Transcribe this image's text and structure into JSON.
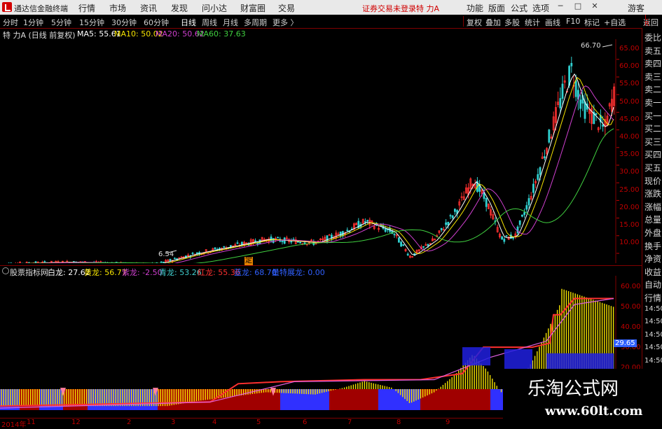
{
  "app": {
    "title": "通达信金融终端"
  },
  "menu": [
    "行情",
    "市场",
    "资讯",
    "发现",
    "问小达",
    "财富圈",
    "交易"
  ],
  "login_warning": "证券交易未登录",
  "stock_name": "特 力A",
  "right_menu": [
    "功能",
    "版面",
    "公式",
    "选项",
    "游客"
  ],
  "periods": [
    "分时",
    "1分钟",
    "5分钟",
    "15分钟",
    "30分钟",
    "60分钟",
    "日线",
    "周线",
    "月线",
    "多周期",
    "更多 〉"
  ],
  "active_period": "日线",
  "tools": [
    "复权",
    "叠加",
    "多股",
    "统计",
    "画线",
    "F10",
    "标记",
    "+自选",
    "返回"
  ],
  "main_chart": {
    "title": "特 力A (日线 前复权)",
    "ma": [
      {
        "label": "MA5: 55.61",
        "color": "#ffffff"
      },
      {
        "label": "MA10: 50.02",
        "color": "#f5e300"
      },
      {
        "label": "MA20: 50.62",
        "color": "#d040d0"
      },
      {
        "label": "MA60: 37.63",
        "color": "#40d040"
      }
    ],
    "high_label": "66.70",
    "low_label": "6.54",
    "price_axis": [
      "65.00",
      "60.00",
      "55.00",
      "50.00",
      "45.00",
      "40.00",
      "35.00",
      "30.00",
      "25.00",
      "20.00",
      "15.00",
      "10.00"
    ],
    "marker": "定"
  },
  "indicator": {
    "name": "股票指标网",
    "items": [
      {
        "label": "白龙: 27.62",
        "color": "#ffffff"
      },
      {
        "label": "黄龙: 56.77",
        "color": "#f5e300"
      },
      {
        "label": "紫龙: -2.50",
        "color": "#d040d0"
      },
      {
        "label": "青龙: 53.26",
        "color": "#40d0d0"
      },
      {
        "label": "红龙: 55.36",
        "color": "#ff3030"
      },
      {
        "label": "蓝龙: 68.70",
        "color": "#3060ff"
      },
      {
        "label": "量特展龙: 0.00",
        "color": "#3060ff"
      }
    ],
    "axis": [
      "60.00",
      "50.00",
      "40.00",
      "30.00",
      "20.00"
    ],
    "current_value": "29.65"
  },
  "right_panel": [
    "委比",
    "卖五",
    "卖四",
    "卖三",
    "卖二",
    "卖一",
    "买一",
    "买二",
    "买三",
    "买四",
    "买五",
    "现价",
    "涨跌",
    "涨幅",
    "总量",
    "外盘",
    "换手",
    "净资",
    "收益",
    "自动",
    "行情",
    "14:50",
    "14:50",
    "14:50",
    "14:50",
    "14:50",
    "14:50"
  ],
  "date_axis": [
    "2014年",
    "11",
    "12",
    "2",
    "3",
    "4",
    "5",
    "6",
    "7",
    "8",
    "9"
  ],
  "watermark": {
    "line1": "乐淘公式网",
    "line2": "www.60lt.com"
  },
  "colors": {
    "up": "#ff3030",
    "down": "#30d0d0",
    "grid": "#800000"
  }
}
